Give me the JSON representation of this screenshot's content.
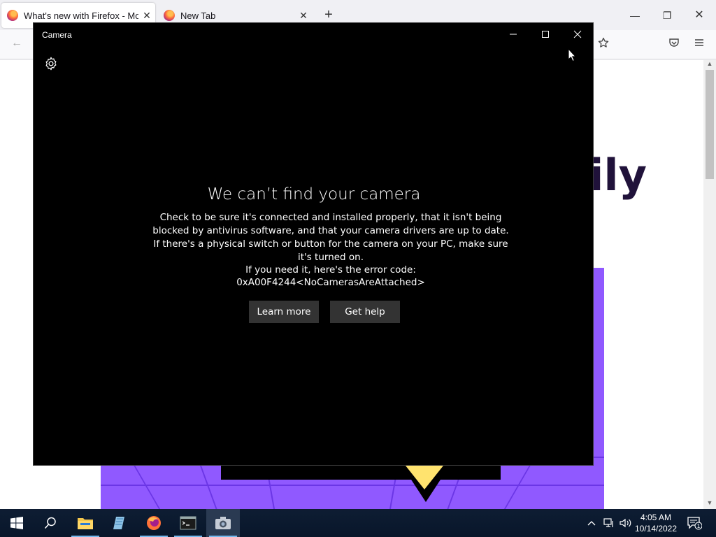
{
  "firefox": {
    "tabs": [
      {
        "title": "What's new with Firefox - More",
        "active": true
      },
      {
        "title": "New Tab",
        "active": false
      }
    ],
    "hero_text": "ily"
  },
  "camera": {
    "title": "Camera",
    "heading": "We can’t find your camera",
    "body": "Check to be sure it's connected and installed properly, that it isn't being blocked by antivirus software, and that your camera drivers are up to date. If there's a physical switch or button for the camera on your PC, make sure it's turned on.",
    "error_label": "If you need it, here's the error code:",
    "error_code": "0xA00F4244<NoCamerasAreAttached>",
    "learn_more": "Learn more",
    "get_help": "Get help"
  },
  "taskbar": {
    "time": "4:05 AM",
    "date": "10/14/2022",
    "notification_count": "1"
  },
  "colors": {
    "camera_bg": "#000000",
    "camera_button": "#333333",
    "promo_purple": "#9059ff",
    "promo_yellow": "#ffe36e"
  }
}
